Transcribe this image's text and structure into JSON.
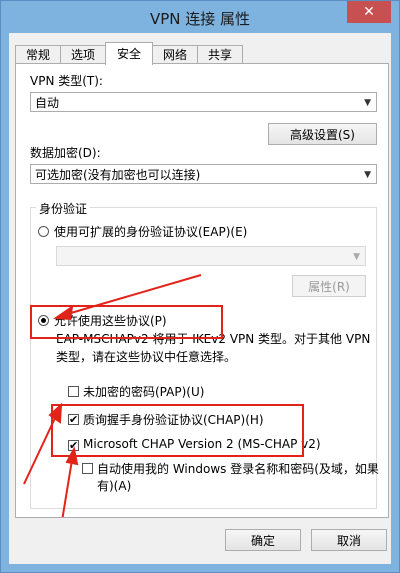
{
  "window": {
    "title": "VPN 连接 属性",
    "close": "✕"
  },
  "tabs": [
    {
      "label": "常规"
    },
    {
      "label": "选项"
    },
    {
      "label": "安全"
    },
    {
      "label": "网络"
    },
    {
      "label": "共享"
    }
  ],
  "security": {
    "vpn_type_label": "VPN 类型(T):",
    "vpn_type_value": "自动",
    "advanced_button": "高级设置(S)",
    "encryption_label": "数据加密(D):",
    "encryption_value": "可选加密(没有加密也可以连接)",
    "auth_group_title": "身份验证",
    "eap_radio_label": "使用可扩展的身份验证协议(EAP)(E)",
    "eap_combo_value": "",
    "properties_button": "属性(R)",
    "allow_protocols_label": "允许使用这些协议(P)",
    "note_line1": "EAP-MSCHAPv2 将用于 IKEv2 VPN 类型。对于其他 VPN",
    "note_line2": "类型，请在这些协议中任意选择。",
    "pap_label": "未加密的密码(PAP)(U)",
    "chap_label": "质询握手身份验证协议(CHAP)(H)",
    "mschap_label": "Microsoft CHAP Version 2 (MS-CHAP v2)",
    "auto_login_line1": "自动使用我的 Windows 登录名称和密码(及域，如果",
    "auto_login_line2": "有)(A)"
  },
  "footer": {
    "ok": "确定",
    "cancel": "取消"
  },
  "checkmark": "✔",
  "arrow_glyph": "▼",
  "colors": {
    "frame": "#7eb3e0",
    "annotation": "#e2231a"
  }
}
